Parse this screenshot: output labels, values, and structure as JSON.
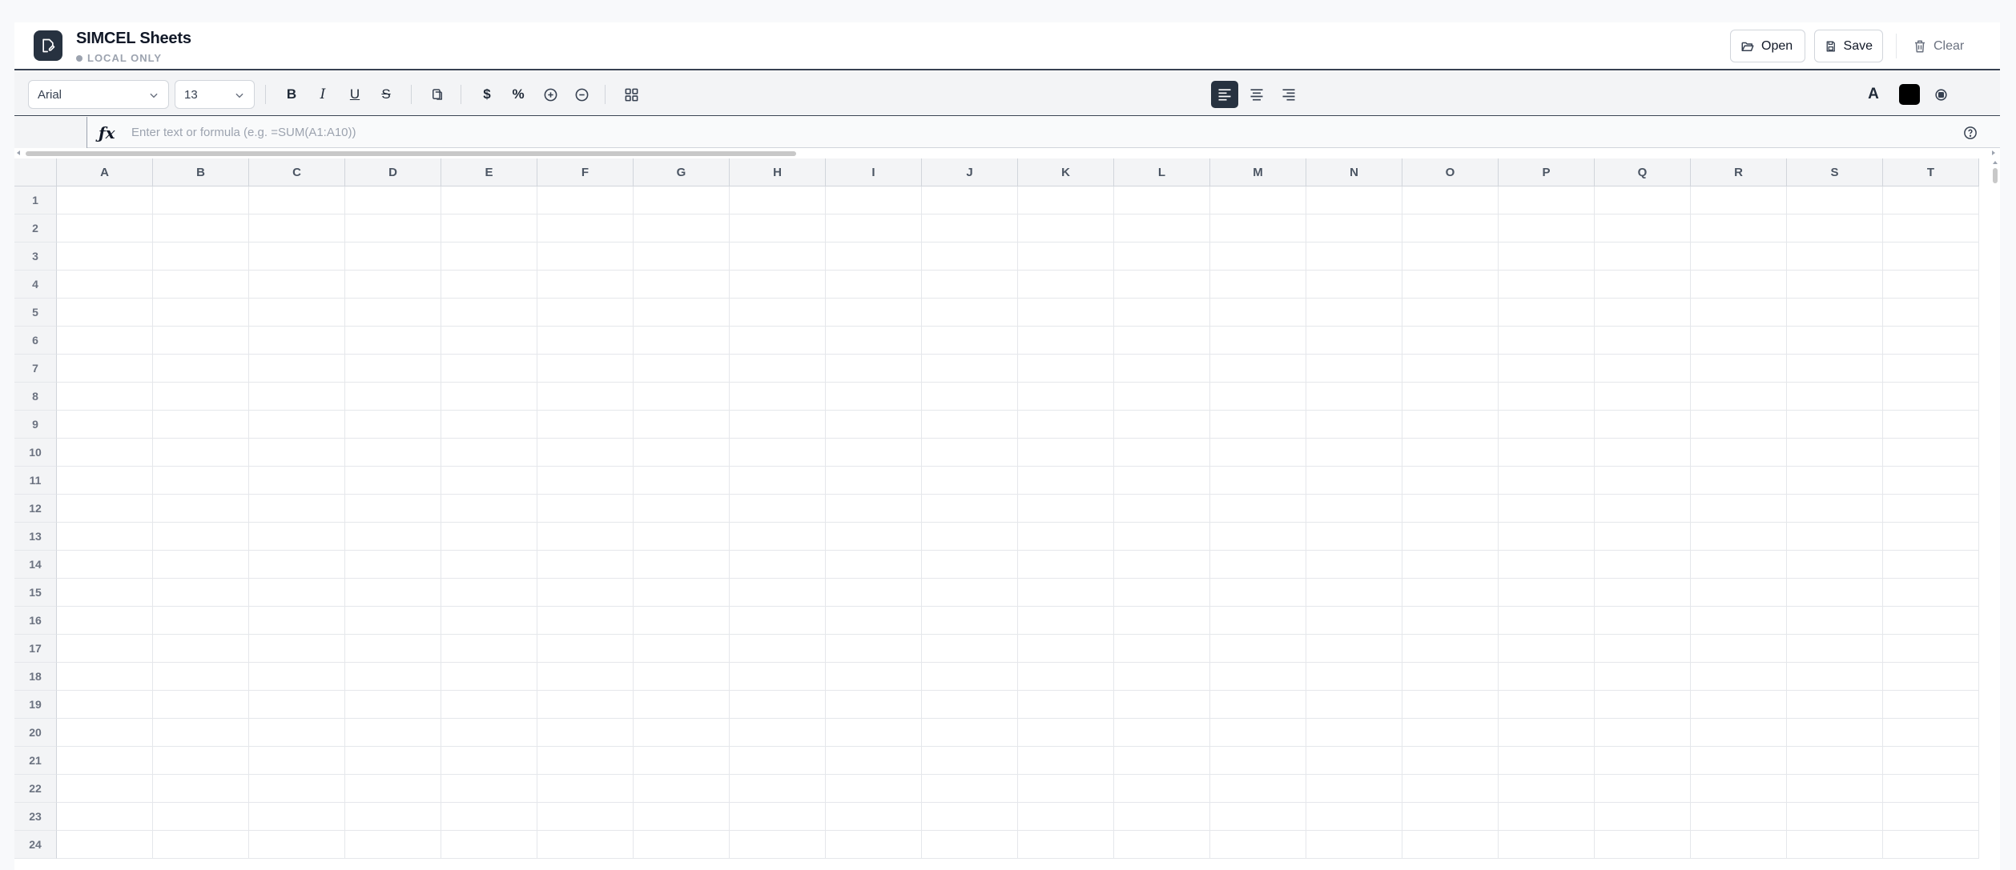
{
  "header": {
    "title": "SIMCEL Sheets",
    "badge": "LOCAL ONLY",
    "open_label": "Open",
    "save_label": "Save",
    "clear_label": "Clear"
  },
  "toolbar": {
    "font_family": "Arial",
    "font_size": "13",
    "bold_label": "B",
    "italic_label": "I",
    "underline_label": "U",
    "strike_label": "S",
    "currency_label": "$",
    "percent_label": "%",
    "text_color_label": "A",
    "fill_color": "#000000",
    "active_alignment": "left"
  },
  "formula_bar": {
    "fx_label": "ƒx",
    "placeholder": "Enter text or formula (e.g. =SUM(A1:A10))",
    "value": ""
  },
  "grid": {
    "columns": [
      "A",
      "B",
      "C",
      "D",
      "E",
      "F",
      "G",
      "H",
      "I",
      "J",
      "K",
      "L",
      "M",
      "N",
      "O",
      "P",
      "Q",
      "R",
      "S",
      "T"
    ],
    "rows": [
      "1",
      "2",
      "3",
      "4",
      "5",
      "6",
      "7",
      "8",
      "9",
      "10",
      "11",
      "12",
      "13",
      "14",
      "15",
      "16",
      "17",
      "18",
      "19",
      "20",
      "21",
      "22",
      "23",
      "24"
    ]
  }
}
